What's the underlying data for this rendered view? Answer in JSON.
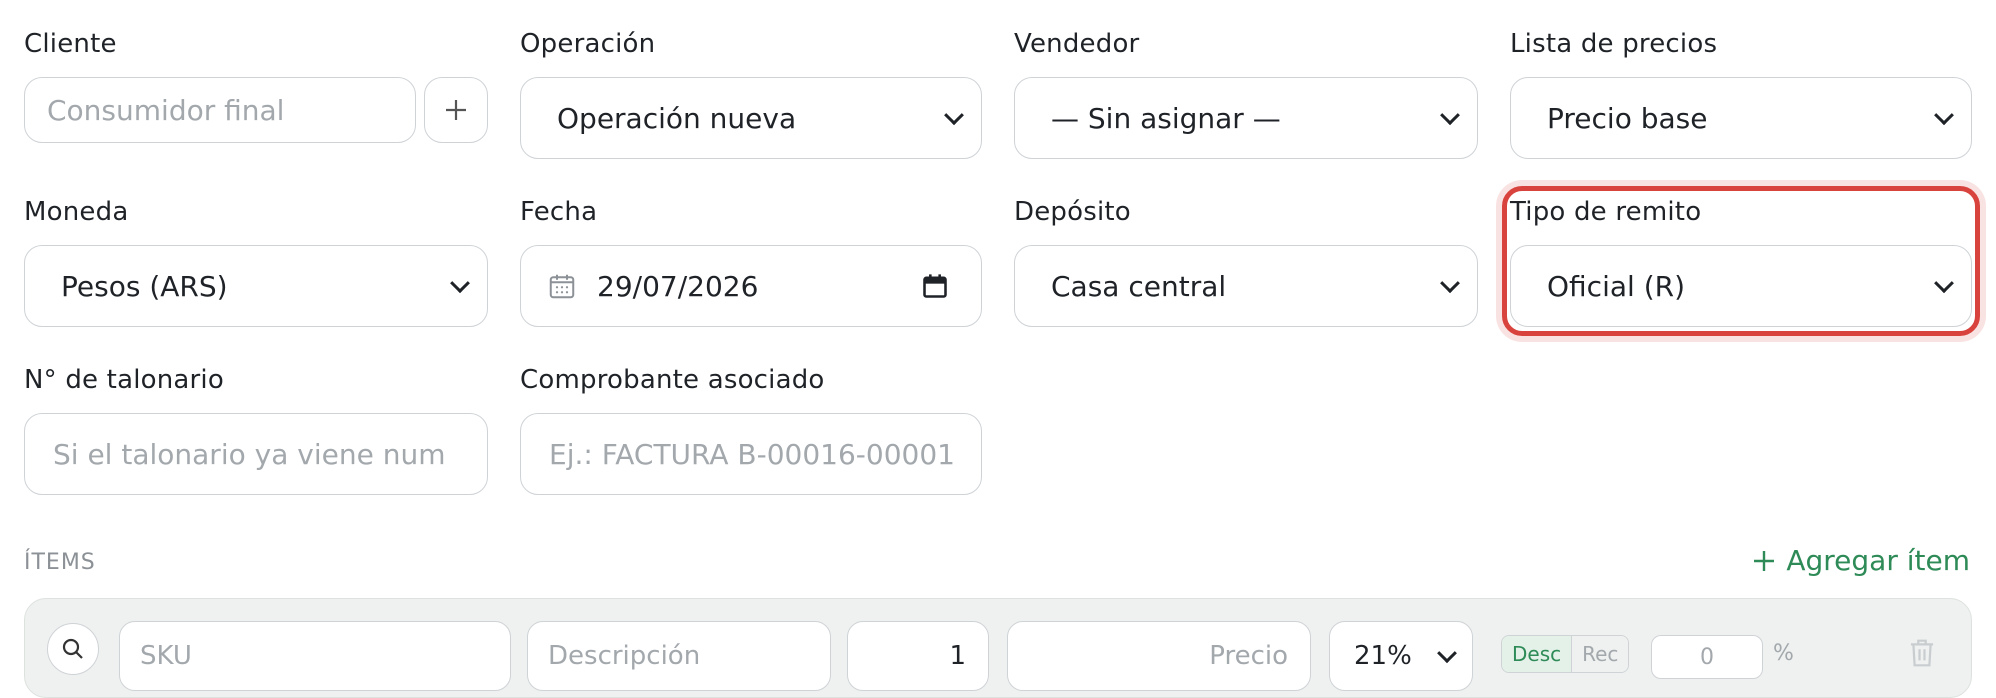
{
  "form": {
    "cliente": {
      "label": "Cliente",
      "placeholder": "Consumidor final"
    },
    "operacion": {
      "label": "Operación",
      "value": "Operación nueva"
    },
    "vendedor": {
      "label": "Vendedor",
      "value": "— Sin asignar —"
    },
    "lista_precios": {
      "label": "Lista de precios",
      "value": "Precio base"
    },
    "moneda": {
      "label": "Moneda",
      "value": "Pesos (ARS)"
    },
    "fecha": {
      "label": "Fecha",
      "value": "29/07/2026"
    },
    "deposito": {
      "label": "Depósito",
      "value": "Casa central"
    },
    "tipo_remito": {
      "label": "Tipo de remito",
      "value": "Oficial (R)"
    },
    "talonario": {
      "label": "N° de talonario",
      "placeholder": "Si el talonario ya viene num"
    },
    "comprobante": {
      "label": "Comprobante asociado",
      "placeholder": "Ej.: FACTURA B-00016-00001"
    }
  },
  "items": {
    "title": "ÍTEMS",
    "add_label": "Agregar ítem",
    "row": {
      "sku_placeholder": "SKU",
      "desc_placeholder": "Descripción",
      "qty": "1",
      "price_placeholder": "Precio",
      "iva": "21%",
      "desc_toggle": "Desc",
      "rec_toggle": "Rec",
      "discount": "0",
      "percent": "%"
    }
  },
  "colors": {
    "accent": "#2e8b57",
    "highlight": "#d9433d"
  },
  "icons": [
    "plus-icon",
    "chevron-down-icon",
    "calendar-icon",
    "calendar-picker-icon",
    "search-icon",
    "trash-icon"
  ]
}
